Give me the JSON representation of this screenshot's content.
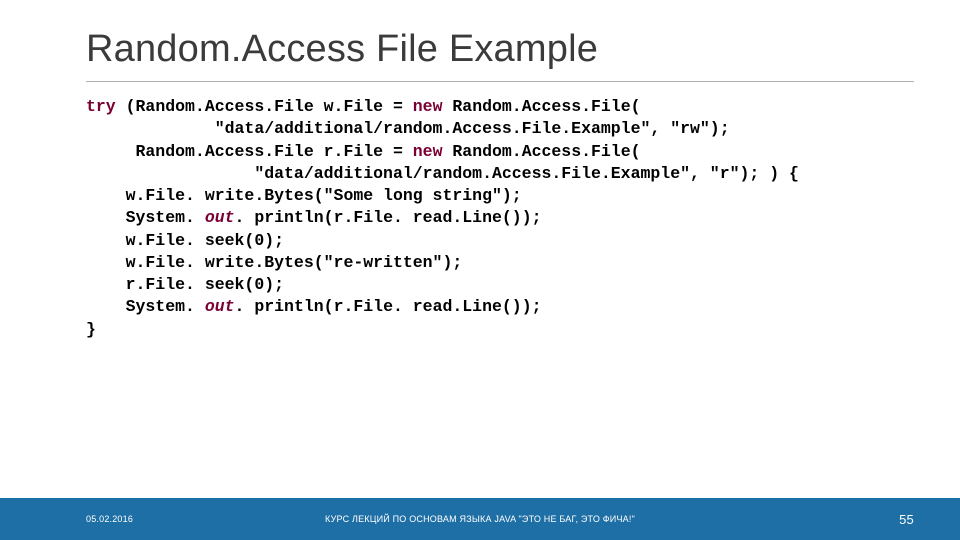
{
  "title": "Random.Access File Example",
  "code": {
    "l1a": "try",
    "l1b": " (Random.Access.File w.File = ",
    "l1c": "new",
    "l1d": " Random.Access.File(",
    "l2": "             \"data/additional/random.Access.File.Example\", \"rw\");",
    "l3a": "     Random.Access.File r.File = ",
    "l3b": "new",
    "l3c": " Random.Access.File(",
    "l4": "                 \"data/additional/random.Access.File.Example\", \"r\"); ) {",
    "l5": "    w.File. write.Bytes(\"Some long string\");",
    "l6a": "    System. ",
    "l6b": "out",
    "l6c": ". println(r.File. read.Line());",
    "l7": "    w.File. seek(0);",
    "l8": "    w.File. write.Bytes(\"re-written\");",
    "l9": "    r.File. seek(0);",
    "l10a": "    System. ",
    "l10b": "out",
    "l10c": ". println(r.File. read.Line());",
    "l11": "}"
  },
  "footer": {
    "date": "05.02.2016",
    "course": "КУРС ЛЕКЦИЙ ПО ОСНОВАМ ЯЗЫКА JAVA \"ЭТО НЕ БАГ, ЭТО ФИЧА!\"",
    "page": "55"
  }
}
